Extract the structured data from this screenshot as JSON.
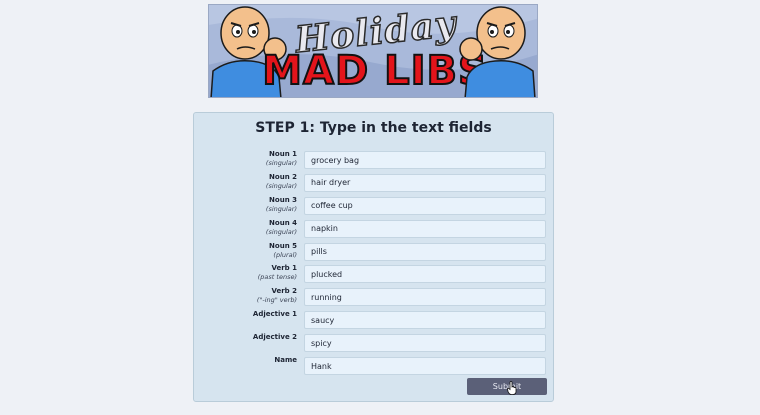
{
  "banner": {
    "line1": "Holiday",
    "line2": "MAD LIBS"
  },
  "form": {
    "title": "STEP 1: Type in the text fields",
    "fields": [
      {
        "label": "Noun 1",
        "hint": "(singular)",
        "value": "grocery bag"
      },
      {
        "label": "Noun 2",
        "hint": "(singular)",
        "value": "hair dryer"
      },
      {
        "label": "Noun 3",
        "hint": "(singular)",
        "value": "coffee cup"
      },
      {
        "label": "Noun 4",
        "hint": "(singular)",
        "value": "napkin"
      },
      {
        "label": "Noun 5",
        "hint": "(plural)",
        "value": "pills"
      },
      {
        "label": "Verb 1",
        "hint": "(past tense)",
        "value": "plucked"
      },
      {
        "label": "Verb 2",
        "hint": "(\"-ing\" verb)",
        "value": "running"
      },
      {
        "label": "Adjective 1",
        "hint": "",
        "value": "saucy"
      },
      {
        "label": "Adjective 2",
        "hint": "",
        "value": "spicy"
      },
      {
        "label": "Name",
        "hint": "",
        "value": "Hank"
      }
    ],
    "submit_label": "Submit"
  },
  "icons": {
    "cursor": "hand-pointer-icon"
  },
  "colors": {
    "page_bg": "#eef1f6",
    "card_bg": "#d6e4ef",
    "field_bg": "#e8f2fb",
    "button_bg": "#5b6078",
    "banner_red": "#e3141b"
  }
}
